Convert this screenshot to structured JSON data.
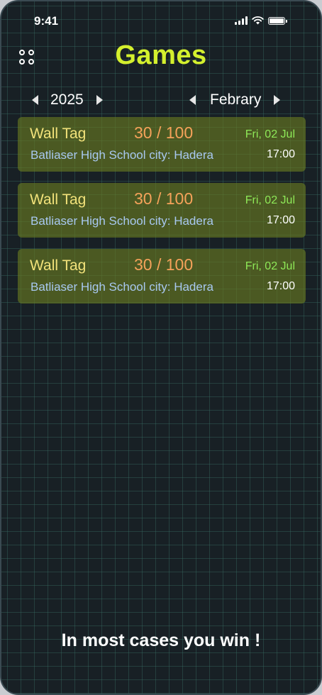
{
  "status_bar": {
    "time": "9:41"
  },
  "header": {
    "title": "Games"
  },
  "filters": {
    "year": "2025",
    "month": "Febrary"
  },
  "games": [
    {
      "name": "Wall Tag",
      "score": "30 / 100",
      "date": "Fri, 02 Jul",
      "venue": "Batliaser High School city: Hadera",
      "time": "17:00"
    },
    {
      "name": "Wall Tag",
      "score": "30 / 100",
      "date": "Fri, 02 Jul",
      "venue": "Batliaser High School city: Hadera",
      "time": "17:00"
    },
    {
      "name": "Wall Tag",
      "score": "30 / 100",
      "date": "Fri, 02 Jul",
      "venue": "Batliaser High School city: Hadera",
      "time": "17:00"
    }
  ],
  "footer": {
    "text": "In most cases you win !"
  },
  "colors": {
    "title": "#d4f02e",
    "card_bg": "#6a7c20",
    "game_name": "#f2e27a",
    "score": "#f5a25a",
    "date": "#8ee858",
    "venue": "#a8c8f0",
    "background": "#182025"
  },
  "icons": [
    "menu-grid-icon",
    "signal-icon",
    "wifi-icon",
    "battery-icon",
    "chevron-left-icon",
    "chevron-right-icon"
  ]
}
